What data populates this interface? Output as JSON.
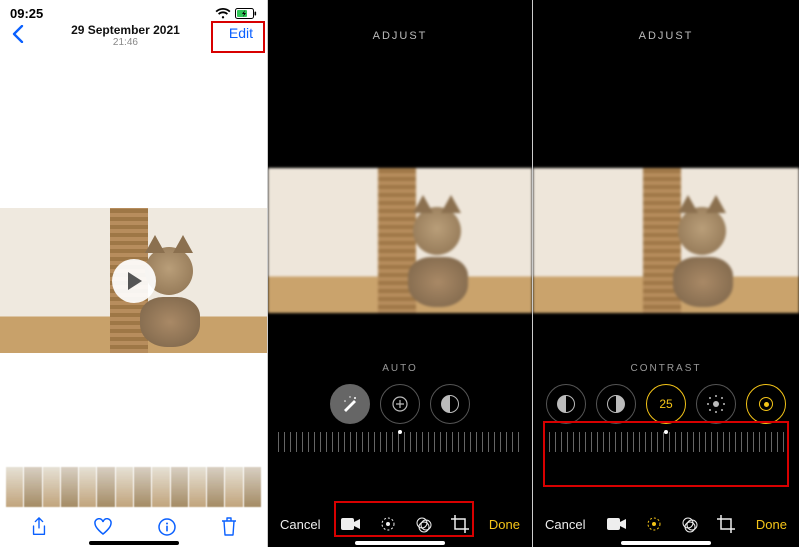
{
  "panel1": {
    "status": {
      "time": "09:25"
    },
    "nav": {
      "date": "29 September 2021",
      "time": "21:46",
      "edit": "Edit"
    },
    "toolbar": {
      "share": "share-icon",
      "favorite": "heart-icon",
      "info": "info-icon",
      "delete": "trash-icon"
    }
  },
  "panel2": {
    "header": "ADJUST",
    "section_label": "AUTO",
    "bottom": {
      "cancel": "Cancel",
      "done": "Done"
    },
    "modes": [
      "video",
      "adjust",
      "filters",
      "crop"
    ]
  },
  "panel3": {
    "header": "ADJUST",
    "section_label": "CONTRAST",
    "contrast_value": "25",
    "bottom": {
      "cancel": "Cancel",
      "done": "Done"
    }
  }
}
